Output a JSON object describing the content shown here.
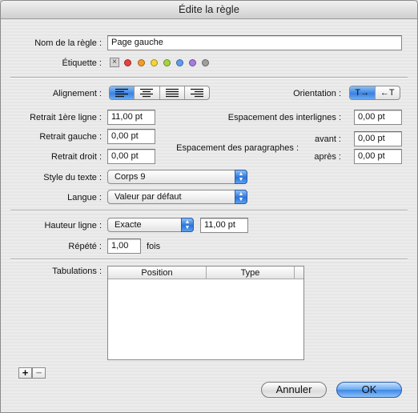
{
  "window": {
    "title": "Édite la règle"
  },
  "rule_name": {
    "label": "Nom de la règle :",
    "value": "Page gauche"
  },
  "tag": {
    "label": "Étiquette :",
    "none_symbol": "×",
    "colors": [
      "#e8413b",
      "#f39c2a",
      "#f4d735",
      "#a3d63e",
      "#5f9bf2",
      "#a67ce0",
      "#9f9f9f"
    ]
  },
  "alignment": {
    "label": "Alignement :",
    "options": [
      "left-align-icon",
      "center-align-icon",
      "justify-icon",
      "right-align-icon"
    ],
    "selected": 0
  },
  "orientation": {
    "label": "Orientation :",
    "options": [
      "ltr-orientation-icon",
      "rtl-orientation-icon"
    ],
    "selected": 0,
    "ltr_glyph": "T→",
    "rtl_glyph": "←T"
  },
  "indent_first": {
    "label": "Retrait 1ère ligne :",
    "value": "11,00 pt"
  },
  "indent_left": {
    "label": "Retrait gauche :",
    "value": "0,00 pt"
  },
  "indent_right": {
    "label": "Retrait droit :",
    "value": "0,00 pt"
  },
  "line_spacing": {
    "label": "Espacement des interlignes :",
    "value": "0,00 pt"
  },
  "para_spacing": {
    "label": "Espacement des paragraphes :",
    "before_label": "avant :",
    "before_value": "0,00 pt",
    "after_label": "après :",
    "after_value": "0,00 pt"
  },
  "text_style": {
    "label": "Style du texte :",
    "value": "Corps 9"
  },
  "language": {
    "label": "Langue :",
    "value": "Valeur par défaut"
  },
  "line_height": {
    "label": "Hauteur ligne :",
    "mode": "Exacte",
    "value": "11,00 pt"
  },
  "repeat": {
    "label": "Répété :",
    "value": "1,00",
    "unit": "fois"
  },
  "tabs": {
    "label": "Tabulations :",
    "columns": [
      "Position",
      "Type"
    ]
  },
  "buttons": {
    "add": "+",
    "remove": "−",
    "cancel": "Annuler",
    "ok": "OK"
  }
}
